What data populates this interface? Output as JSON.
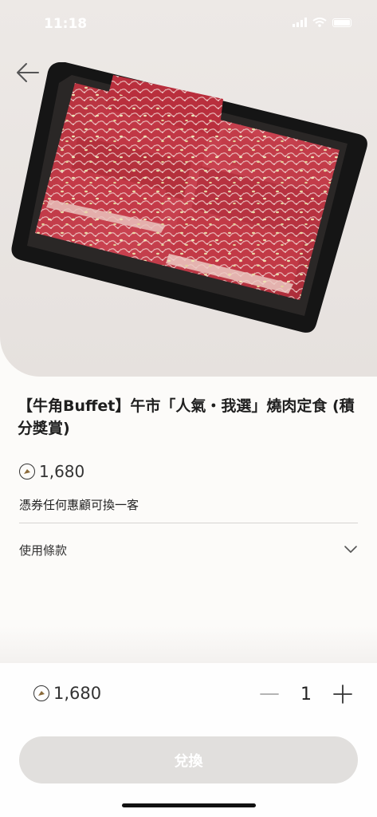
{
  "status_bar": {
    "time": "11:18"
  },
  "product": {
    "title": "【牛角Buffet】午市「人氣・我選」燒肉定食 (積分獎賞)",
    "price": "1,680",
    "description": "憑券任何惠顧可換一客"
  },
  "terms": {
    "label": "使用條款"
  },
  "bottom": {
    "price": "1,680",
    "quantity": "1",
    "redeem_label": "兌換"
  },
  "icons": {
    "back": "arrow-left-icon",
    "coin": "points-coin-icon",
    "expand": "chevron-down-icon",
    "minus": "minus-icon",
    "plus": "plus-icon"
  },
  "colors": {
    "hero_bg": "#ede9e6",
    "button_disabled": "#e1dfdd",
    "page_bg": "#fcfbf9"
  }
}
